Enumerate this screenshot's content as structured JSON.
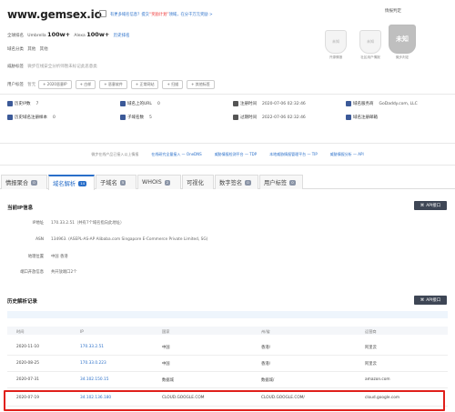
{
  "header": {
    "domain": "www.gemsex.io",
    "notice_prefix": "有更多域名信息？提交",
    "notice_highlight": "“奖励计划”",
    "notice_suffix": "领域，在分千万元奖励 >",
    "verdict_label": "情报判定",
    "global_rank_label": "全球排名",
    "umbrella_label": "Umbrella",
    "umbrella_value": "100w+",
    "alexa_label": "Alexa",
    "alexa_value": "100w+",
    "history_rank_link": "历史排名",
    "category_label": "域名分类",
    "category_value_1": "其他",
    "category_value_2": "其他",
    "threat_label": "威胁标签",
    "threat_value": "微步在线安全分析师暂未标记此恶意类",
    "user_tags_label": "用户标签",
    "user_tags_prefix": "暂无",
    "user_tags": [
      "+ 2020恶意IP",
      "+ 白样",
      "+ 恶意软件",
      "+ 正常网站",
      "+ 扫描",
      "+ 其他标签"
    ]
  },
  "badges": [
    {
      "text": "未知",
      "caption": "开源情报"
    },
    {
      "text": "未知",
      "caption": "社区用户情报"
    },
    {
      "text": "未知",
      "caption": "微步判定"
    }
  ],
  "stats": [
    {
      "label": "历史IP数",
      "value": "7"
    },
    {
      "label": "域名上的URL",
      "value": "0"
    },
    {
      "label": "注册时间",
      "value": "2020-07-06 02:32:46"
    },
    {
      "label": "域名服务商",
      "value": "GoDaddy.com, LLC"
    },
    {
      "label": "历史域名注册样本",
      "value": "0"
    },
    {
      "label": "子域名数",
      "value": "5"
    },
    {
      "label": "过期时间",
      "value": "2022-07-06 02:32:46"
    },
    {
      "label": "域名注册邮箱",
      "value": ""
    }
  ],
  "promos": [
    "微步在线产品已接入以上情报",
    "在线研究全量接入 — OneDNS",
    "威胁情报检测平台 — TDP",
    "本地威胁情报管理平台 — TIP",
    "威胁情报分析 — API"
  ],
  "tabs": [
    {
      "label": "情报聚合",
      "count": "0"
    },
    {
      "label": "域名解析",
      "count": "14"
    },
    {
      "label": "子域名",
      "count": "5"
    },
    {
      "label": "WHOIS",
      "count": "2"
    },
    {
      "label": "可视化",
      "count": ""
    },
    {
      "label": "数字签名",
      "count": "0"
    },
    {
      "label": "用户标签",
      "count": "0"
    }
  ],
  "current_ip": {
    "title": "当前IP信息",
    "api_label": "API接口",
    "rows": [
      {
        "k": "IP地址",
        "v": "170.33.2.51（共有7个域名指向此地址）"
      },
      {
        "k": "ASN",
        "v": "134963. (ASEPL-AS-AP Alibaba.com Singapore E-Commerce Private Limited, SG)"
      },
      {
        "k": "地理位置",
        "v": "中国 香港"
      },
      {
        "k": "端口开放信息",
        "v": "共开放端口2个"
      }
    ]
  },
  "history": {
    "title": "历史解析记录",
    "api_label": "API接口",
    "columns": [
      "时间",
      "IP",
      "国家",
      "州/省",
      "运营商"
    ],
    "rows": [
      {
        "time": "2020-11-10",
        "ip": "170.33.2.51",
        "country": "中国",
        "province": "香港/",
        "isp": "阿里云"
      },
      {
        "time": "2020-08-25",
        "ip": "170.33.0.223",
        "country": "中国",
        "province": "香港/",
        "isp": "阿里云"
      },
      {
        "time": "2020-07-31",
        "ip": "34.102.150.15",
        "country": "数据城",
        "province": "数据城/",
        "isp": "amazon.com"
      },
      {
        "time": "2020-07-19",
        "ip": "34.102.136.180",
        "country": "CLOUD.GOOGLE.COM",
        "province": "CLOUD.GOOGLE.COM/",
        "isp": "cloud.google.com"
      }
    ]
  }
}
